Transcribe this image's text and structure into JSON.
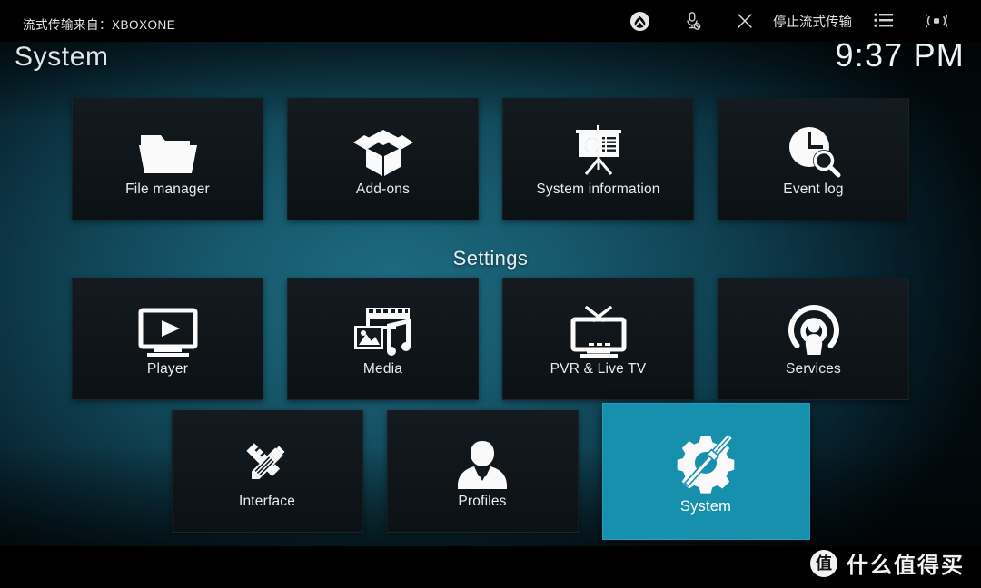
{
  "stream_bar": {
    "source_label": "流式传输来自：XBOXONE",
    "stop_label": "停止流式传输",
    "icons": {
      "xbox": "xbox-logo-icon",
      "mic_muted": "microphone-muted-icon",
      "close": "close-icon",
      "menu": "list-menu-icon",
      "signal": "signal-strength-icon"
    }
  },
  "header": {
    "title": "System",
    "clock": "9:37 PM"
  },
  "sections": {
    "settings_heading": "Settings"
  },
  "rows": {
    "row1": [
      {
        "label": "File manager",
        "icon": "folder-open-icon",
        "selected": false
      },
      {
        "label": "Add-ons",
        "icon": "open-box-icon",
        "selected": false
      },
      {
        "label": "System information",
        "icon": "presentation-chart-icon",
        "selected": false
      },
      {
        "label": "Event log",
        "icon": "clock-search-icon",
        "selected": false
      }
    ],
    "row2": [
      {
        "label": "Player",
        "icon": "monitor-play-icon",
        "selected": false
      },
      {
        "label": "Media",
        "icon": "film-photo-music-icon",
        "selected": false
      },
      {
        "label": "PVR & Live TV",
        "icon": "tv-antenna-icon",
        "selected": false
      },
      {
        "label": "Services",
        "icon": "broadcast-person-icon",
        "selected": false
      }
    ],
    "row3": [
      {
        "label": "Interface",
        "icon": "pencil-ruler-icon",
        "selected": false
      },
      {
        "label": "Profiles",
        "icon": "person-bust-icon",
        "selected": false
      },
      {
        "label": "System",
        "icon": "gear-screwdriver-icon",
        "selected": true
      }
    ]
  },
  "watermark": {
    "logo_char": "值",
    "text": "什么值得买"
  },
  "colors": {
    "highlight": "#1790ae",
    "tile_bg": "#121a1f",
    "background_teal": "#17596d",
    "text": "#e7eef1"
  }
}
